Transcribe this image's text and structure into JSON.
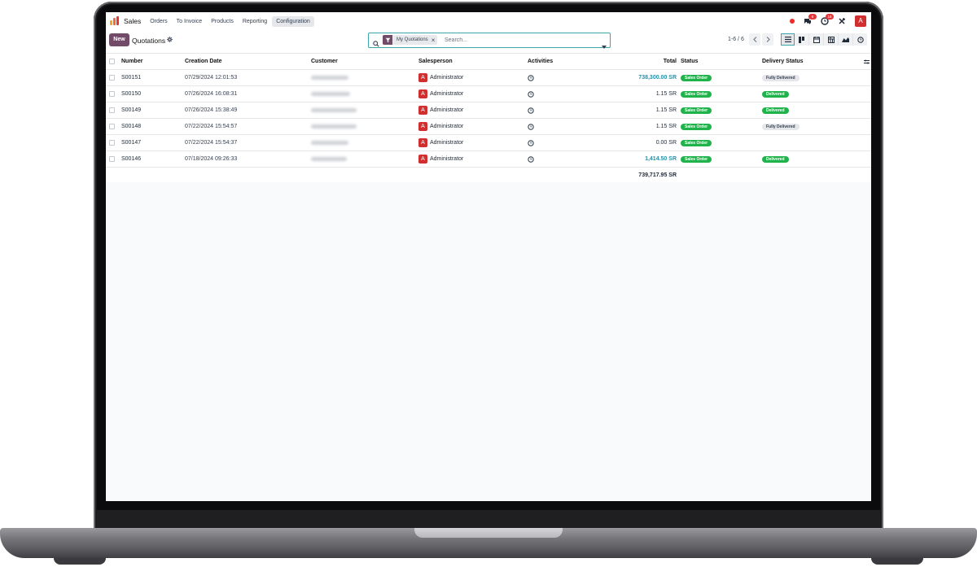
{
  "navbar": {
    "app_name": "Sales",
    "menu": [
      "Orders",
      "To Invoice",
      "Products",
      "Reporting",
      "Configuration"
    ],
    "active_menu": "Configuration",
    "messages_badge": "6",
    "activities_badge": "18",
    "user_initial": "A"
  },
  "control_panel": {
    "new_label": "New",
    "breadcrumb": "Quotations",
    "search": {
      "facet": "My Quotations",
      "placeholder": "Search..."
    },
    "pager": "1-6 / 6"
  },
  "table": {
    "columns": [
      "Number",
      "Creation Date",
      "Customer",
      "Salesperson",
      "Activities",
      "Total",
      "Status",
      "Delivery Status"
    ],
    "rows": [
      {
        "number": "S00151",
        "date": "07/29/2024 12:01:53",
        "salesperson": "Administrator",
        "total": "738,300.00 SR",
        "status": "Sales Order",
        "delivery": "Fully Delivered"
      },
      {
        "number": "S00150",
        "date": "07/26/2024 16:08:31",
        "salesperson": "Administrator",
        "total": "1.15 SR",
        "status": "Sales Order",
        "delivery": "Delivered"
      },
      {
        "number": "S00149",
        "date": "07/26/2024 15:38:49",
        "salesperson": "Administrator",
        "total": "1.15 SR",
        "status": "Sales Order",
        "delivery": "Delivered"
      },
      {
        "number": "S00148",
        "date": "07/22/2024 15:54:57",
        "salesperson": "Administrator",
        "total": "1.15 SR",
        "status": "Sales Order",
        "delivery": "Fully Delivered"
      },
      {
        "number": "S00147",
        "date": "07/22/2024 15:54:37",
        "salesperson": "Administrator",
        "total": "0.00 SR",
        "status": "Sales Order",
        "delivery": ""
      },
      {
        "number": "S00146",
        "date": "07/18/2024 09:26:33",
        "salesperson": "Administrator",
        "total": "1,414.50 SR",
        "status": "Sales Order",
        "delivery": "Delivered"
      }
    ],
    "sum_total": "739,717.95 SR"
  },
  "colors": {
    "brand": "#714b67",
    "accent": "#3aa6a8",
    "link_total": "#2b8fa6",
    "status_green": "#21b34b",
    "avatar_red": "#d12f2f"
  }
}
